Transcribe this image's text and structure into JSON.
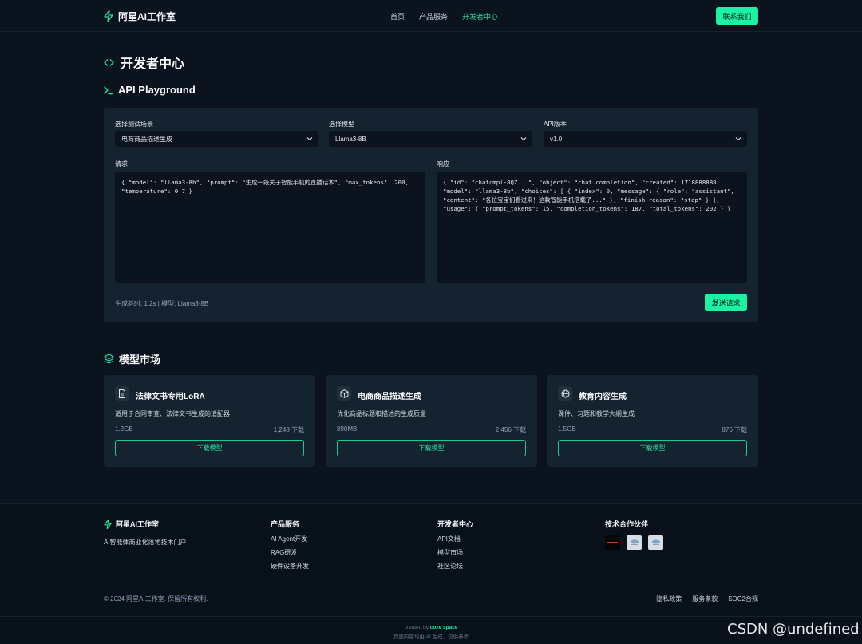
{
  "header": {
    "brand": "阿星AI工作室",
    "nav": [
      "首页",
      "产品服务",
      "开发者中心"
    ],
    "contact_label": "联系我们"
  },
  "page": {
    "title": "开发者中心"
  },
  "playground": {
    "title": "API Playground",
    "scenario_label": "选择测试场景",
    "scenario_value": "电商商品描述生成",
    "model_label": "选择模型",
    "model_value": "Llama3-8B",
    "version_label": "API版本",
    "version_value": "v1.0",
    "request_label": "请求",
    "request_body": "{ \"model\": \"llama3-8b\", \"prompt\": \"生成一段关于智能手机的直播话术\", \"max_tokens\": 200, \"temperature\": 0.7 }",
    "response_label": "响应",
    "response_body": "{ \"id\": \"chatcmpl-8QZ...\", \"object\": \"chat.completion\", \"created\": 1718888888, \"model\": \"llama3-8b\", \"choices\": [ { \"index\": 0, \"message\": { \"role\": \"assistant\", \"content\": \"各位宝宝们看过来！这款智能手机搭载了...\" }, \"finish_reason\": \"stop\" } ], \"usage\": { \"prompt_tokens\": 15, \"completion_tokens\": 187, \"total_tokens\": 202 } }",
    "meta": "生成耗时: 1.2s | 模型: Llama3-8B",
    "send_label": "发送请求"
  },
  "market": {
    "title": "模型市场",
    "cards": [
      {
        "icon": "document-icon",
        "title": "法律文书专用LoRA",
        "desc": "适用于合同审查、法律文书生成的适配器",
        "size": "1.2GB",
        "downloads": "1,248 下载",
        "button": "下载模型"
      },
      {
        "icon": "box-icon",
        "title": "电商商品描述生成",
        "desc": "优化商品标题和描述的生成质量",
        "size": "890MB",
        "downloads": "2,456 下载",
        "button": "下载模型"
      },
      {
        "icon": "globe-icon",
        "title": "教育内容生成",
        "desc": "课件、习题和教学大纲生成",
        "size": "1.5GB",
        "downloads": "876 下载",
        "button": "下载模型"
      }
    ]
  },
  "footer": {
    "brand": "阿星AI工作室",
    "tagline": "AI智能体商业化落地技术门户",
    "products_title": "产品服务",
    "products": [
      "AI Agent开发",
      "RAG研发",
      "硬件设备开发"
    ],
    "dev_title": "开发者中心",
    "dev_links": [
      "API文档",
      "模型市场",
      "社区论坛"
    ],
    "partners_title": "技术合作伙伴",
    "copyright": "© 2024 阿星AI工作室. 保留所有权利.",
    "legal": [
      "隐私政策",
      "服务条款",
      "SOC2合规"
    ],
    "created_prefix": "created by",
    "created_brand": "coze space",
    "disclaimer": "页面内容均由 AI 生成，仅供参考"
  },
  "watermark": "CSDN @undefined",
  "colors": {
    "accent": "#1cf2a3",
    "background": "#0b141e",
    "panel": "#15222f"
  }
}
